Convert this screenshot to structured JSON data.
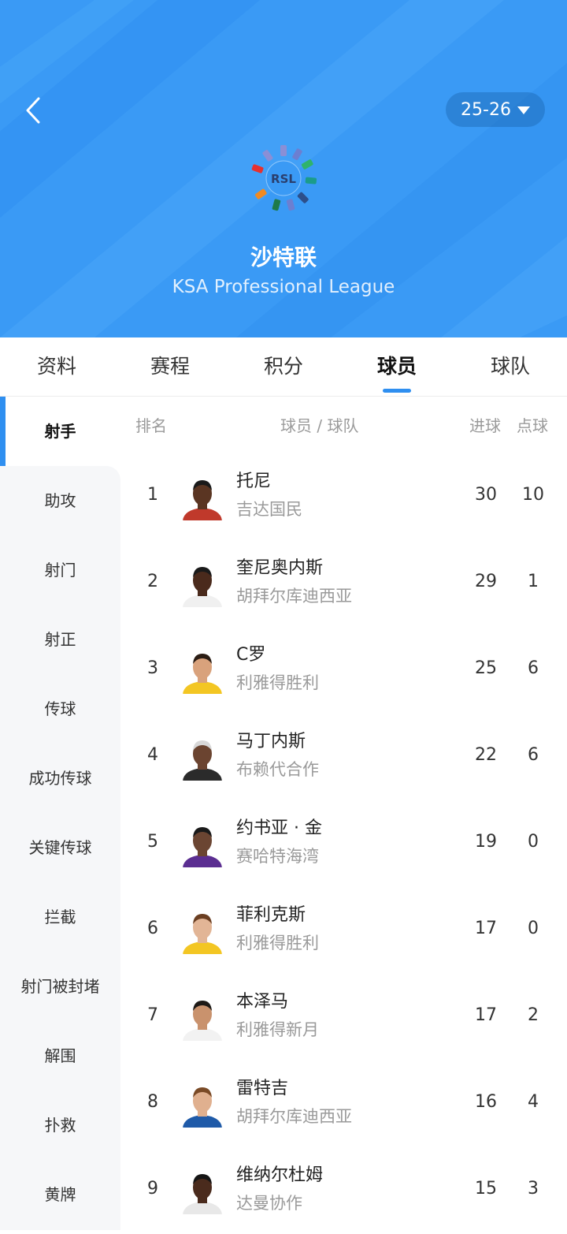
{
  "header": {
    "season": "25-26",
    "logo_text": "RSL",
    "league_name": "沙特联",
    "league_en": "KSA Professional League",
    "bg_color": "#3a9af5"
  },
  "tabs": [
    {
      "label": "资料",
      "active": false
    },
    {
      "label": "赛程",
      "active": false
    },
    {
      "label": "积分",
      "active": false
    },
    {
      "label": "球员",
      "active": true
    },
    {
      "label": "球队",
      "active": false
    }
  ],
  "sidebar": {
    "items": [
      {
        "label": "射手",
        "active": true
      },
      {
        "label": "助攻"
      },
      {
        "label": "射门"
      },
      {
        "label": "射正"
      },
      {
        "label": "传球"
      },
      {
        "label": "成功传球"
      },
      {
        "label": "关键传球"
      },
      {
        "label": "拦截"
      },
      {
        "label": "射门被封堵"
      },
      {
        "label": "解围"
      },
      {
        "label": "扑救"
      },
      {
        "label": "黄牌"
      }
    ]
  },
  "table": {
    "headers": {
      "rank": "排名",
      "player": "球员 / 球队",
      "goals": "进球",
      "penalties": "点球"
    },
    "rows": [
      {
        "rank": "1",
        "name": "托尼",
        "team": "吉达国民",
        "goals": "30",
        "penalties": "10",
        "skin": "#5a3522",
        "shirt": "#c0392b",
        "hair": "#1a1a1a"
      },
      {
        "rank": "2",
        "name": "奎尼奥内斯",
        "team": "胡拜尔库迪西亚",
        "goals": "29",
        "penalties": "1",
        "skin": "#4a2a1c",
        "shirt": "#f0f0f0",
        "hair": "#1a1a1a"
      },
      {
        "rank": "3",
        "name": "C罗",
        "team": "利雅得胜利",
        "goals": "25",
        "penalties": "6",
        "skin": "#d9a27c",
        "shirt": "#f3c623",
        "hair": "#2b1d14"
      },
      {
        "rank": "4",
        "name": "马丁内斯",
        "team": "布赖代合作",
        "goals": "22",
        "penalties": "6",
        "skin": "#6b4430",
        "shirt": "#2b2b2b",
        "hair": "#d8d8d8"
      },
      {
        "rank": "5",
        "name": "约书亚 · 金",
        "team": "赛哈特海湾",
        "goals": "19",
        "penalties": "0",
        "skin": "#6b4532",
        "shirt": "#5b2e91",
        "hair": "#1a1a1a"
      },
      {
        "rank": "6",
        "name": "菲利克斯",
        "team": "利雅得胜利",
        "goals": "17",
        "penalties": "0",
        "skin": "#e2b596",
        "shirt": "#f3c623",
        "hair": "#6b3f22"
      },
      {
        "rank": "7",
        "name": "本泽马",
        "team": "利雅得新月",
        "goals": "17",
        "penalties": "2",
        "skin": "#c9926d",
        "shirt": "#f2f2f2",
        "hair": "#1e1a17"
      },
      {
        "rank": "8",
        "name": "雷特吉",
        "team": "胡拜尔库迪西亚",
        "goals": "16",
        "penalties": "4",
        "skin": "#e0b08f",
        "shirt": "#1f5aa8",
        "hair": "#7a4a26"
      },
      {
        "rank": "9",
        "name": "维纳尔杜姆",
        "team": "达曼协作",
        "goals": "15",
        "penalties": "3",
        "skin": "#4a2b1d",
        "shirt": "#e8e8e8",
        "hair": "#151515"
      }
    ]
  }
}
